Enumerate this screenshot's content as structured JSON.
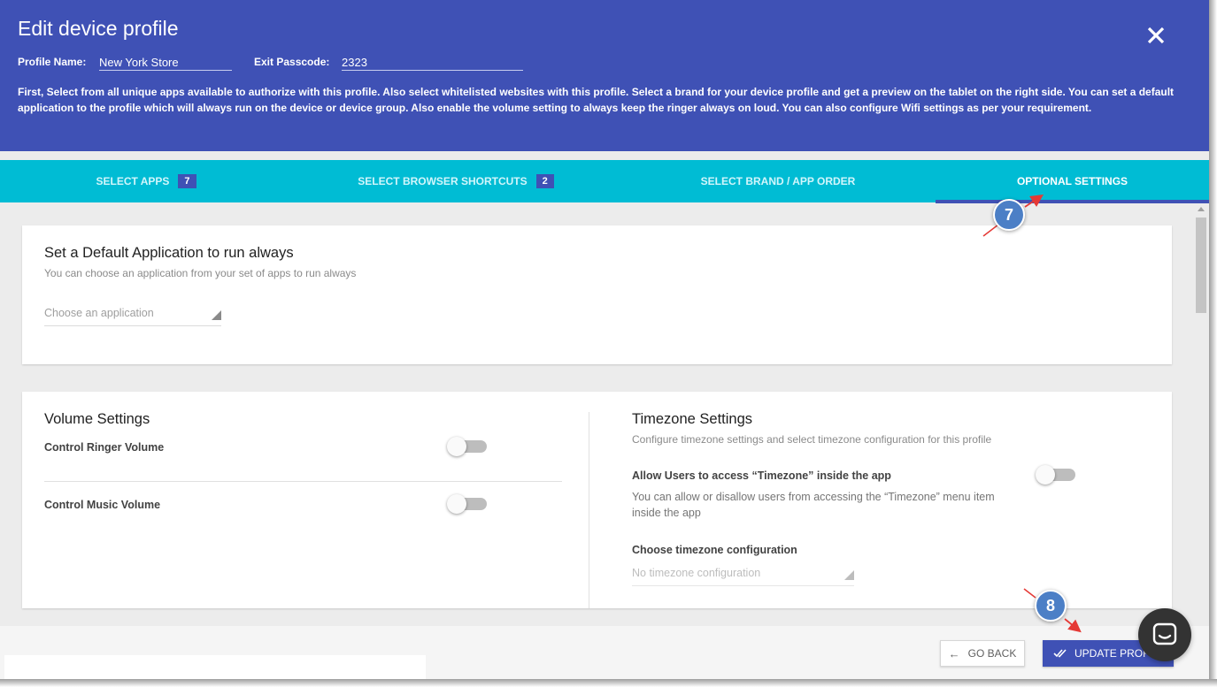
{
  "header": {
    "title": "Edit device profile",
    "profile_name_label": "Profile Name:",
    "profile_name_value": "New York Store",
    "exit_passcode_label": "Exit Passcode:",
    "exit_passcode_value": "2323",
    "description": "First, Select from all unique apps available to authorize with this profile. Also select whitelisted websites with this profile. Select a brand for your device profile and get a preview on the tablet on the right side. You can set a default application to the profile which will always run on the device or device group. Also enable the volume setting to always keep the ringer always on loud. You can also configure Wifi settings as per your requirement.",
    "close_icon": "close-icon"
  },
  "tabs": [
    {
      "label": "SELECT APPS",
      "badge": "7"
    },
    {
      "label": "SELECT BROWSER SHORTCUTS",
      "badge": "2"
    },
    {
      "label": "SELECT BRAND / APP ORDER"
    },
    {
      "label": "OPTIONAL SETTINGS",
      "active": true
    }
  ],
  "default_app": {
    "title": "Set a Default Application to run always",
    "subtitle": "You can choose an application from your set of apps to run always",
    "placeholder": "Choose an application"
  },
  "volume": {
    "title": "Volume Settings",
    "ringer_label": "Control Ringer Volume",
    "ringer_on": false,
    "music_label": "Control Music Volume",
    "music_on": false
  },
  "timezone": {
    "title": "Timezone Settings",
    "subtitle": "Configure timezone settings and select timezone configuration for this profile",
    "allow_label": "Allow Users to access “Timezone” inside the app",
    "allow_desc": "You can allow or disallow users from accessing the “Timezone” menu item inside the app",
    "allow_on": false,
    "config_label": "Choose timezone configuration",
    "config_placeholder": "No timezone configuration"
  },
  "footer": {
    "back_label": "GO BACK",
    "update_label": "UPDATE PROFILE"
  },
  "annotations": {
    "step_7": "7",
    "step_8": "8",
    "arrow_color": "#e53935"
  },
  "colors": {
    "header_bg": "#3f51b5",
    "tab_bar_bg": "#00bcd4",
    "accent": "#3f51b5"
  }
}
